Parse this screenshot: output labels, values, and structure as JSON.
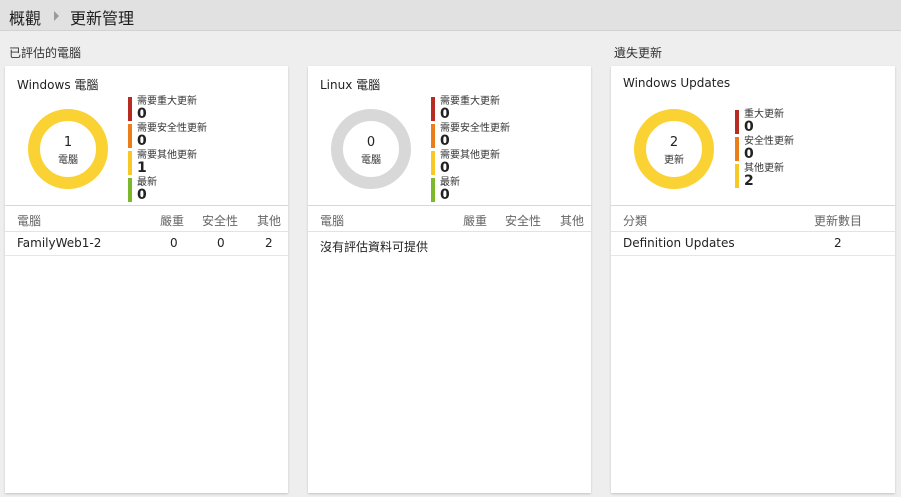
{
  "breadcrumb": {
    "root": "概觀",
    "current": "更新管理"
  },
  "sections": {
    "assessed": "已評估的電腦",
    "missing": "遺失更新"
  },
  "colors": {
    "critical": "#b82b23",
    "security": "#ec7e1a",
    "other": "#f8c924",
    "uptodate": "#7cb92a",
    "donut_main": "#fbd234",
    "donut_empty": "#d8d8d8"
  },
  "windows_tile": {
    "title": "Windows 電腦",
    "donut_count": "1",
    "donut_label": "電腦",
    "legend": [
      {
        "label": "需要重大更新",
        "value": "0",
        "color": "#b82b23"
      },
      {
        "label": "需要安全性更新",
        "value": "0",
        "color": "#ec7e1a"
      },
      {
        "label": "需要其他更新",
        "value": "1",
        "color": "#f8c924"
      },
      {
        "label": "最新",
        "value": "0",
        "color": "#7cb92a"
      }
    ],
    "table": {
      "headers": [
        "電腦",
        "嚴重",
        "安全性",
        "其他"
      ],
      "rows": [
        {
          "name": "FamilyWeb1-2",
          "critical": "0",
          "security": "0",
          "other": "2"
        }
      ]
    }
  },
  "linux_tile": {
    "title": "Linux 電腦",
    "donut_count": "0",
    "donut_label": "電腦",
    "legend": [
      {
        "label": "需要重大更新",
        "value": "0",
        "color": "#b82b23"
      },
      {
        "label": "需要安全性更新",
        "value": "0",
        "color": "#ec7e1a"
      },
      {
        "label": "需要其他更新",
        "value": "0",
        "color": "#f8c924"
      },
      {
        "label": "最新",
        "value": "0",
        "color": "#7cb92a"
      }
    ],
    "table": {
      "headers": [
        "電腦",
        "嚴重",
        "安全性",
        "其他"
      ],
      "empty_text": "沒有評估資料可提供"
    }
  },
  "updates_tile": {
    "title": "Windows Updates",
    "donut_count": "2",
    "donut_label": "更新",
    "legend": [
      {
        "label": "重大更新",
        "value": "0",
        "color": "#b82b23"
      },
      {
        "label": "安全性更新",
        "value": "0",
        "color": "#ec7e1a"
      },
      {
        "label": "其他更新",
        "value": "2",
        "color": "#f8c924"
      }
    ],
    "table": {
      "headers": [
        "分類",
        "更新數目"
      ],
      "rows": [
        {
          "category": "Definition Updates",
          "count": "2"
        }
      ]
    }
  }
}
